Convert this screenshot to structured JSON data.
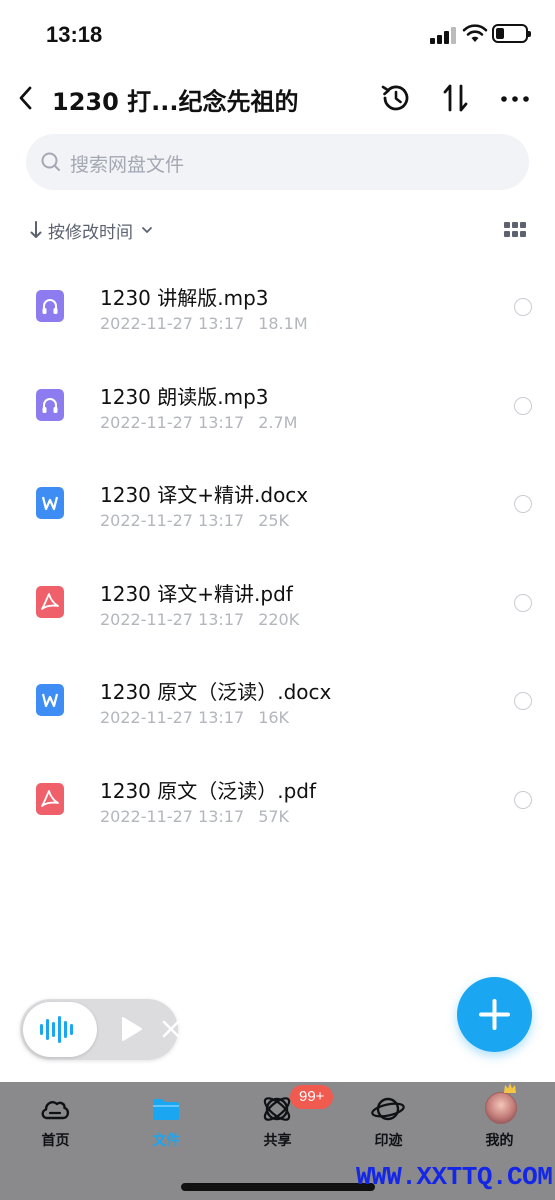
{
  "status_bar": {
    "time": "13:18"
  },
  "nav": {
    "title": "1230 打...纪念先祖的"
  },
  "search": {
    "placeholder": "搜索网盘文件"
  },
  "sort": {
    "label": "按修改时间"
  },
  "files": [
    {
      "name": "1230 讲解版.mp3",
      "date": "2022-11-27 13:17",
      "size": "18.1M",
      "type": "audio"
    },
    {
      "name": "1230 朗读版.mp3",
      "date": "2022-11-27 13:17",
      "size": "2.7M",
      "type": "audio"
    },
    {
      "name": "1230 译文+精讲.docx",
      "date": "2022-11-27 13:17",
      "size": "25K",
      "type": "word"
    },
    {
      "name": "1230 译文+精讲.pdf",
      "date": "2022-11-27 13:17",
      "size": "220K",
      "type": "pdf"
    },
    {
      "name": "1230 原文（泛读）.docx",
      "date": "2022-11-27 13:17",
      "size": "16K",
      "type": "word"
    },
    {
      "name": "1230 原文（泛读）.pdf",
      "date": "2022-11-27 13:17",
      "size": "57K",
      "type": "pdf"
    }
  ],
  "tabs": [
    {
      "label": "首页",
      "icon": "cloud-icon"
    },
    {
      "label": "文件",
      "icon": "folder-icon",
      "active": true
    },
    {
      "label": "共享",
      "icon": "share-orbit-icon"
    },
    {
      "label": "印迹",
      "icon": "planet-icon"
    },
    {
      "label": "我的",
      "icon": "avatar"
    }
  ],
  "share_badge": "99+",
  "watermark": "WWW.XXTTQ.COM",
  "colors": {
    "accent": "#1ba6f2",
    "audio_icon": "#8c7cf0",
    "word_icon": "#3d8df5",
    "pdf_icon": "#f0606b",
    "badge": "#f05a4f"
  }
}
